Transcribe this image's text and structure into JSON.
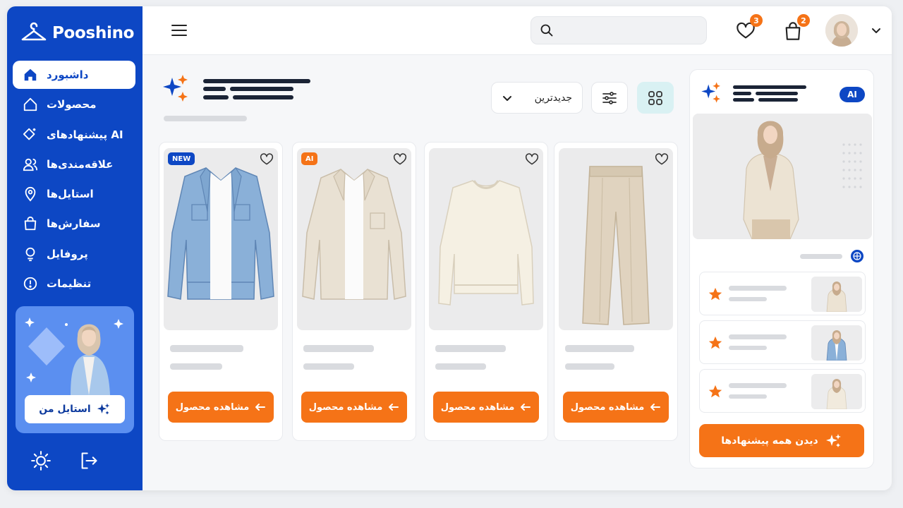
{
  "app": {
    "brand": "Pooshino"
  },
  "sidebar": {
    "items": [
      {
        "label": "داشبورد",
        "icon": "home-icon",
        "active": true
      },
      {
        "label": "محصولات",
        "icon": "tag-icon"
      },
      {
        "label": "پیشنهادهای AI",
        "icon": "ai-sparkle-icon"
      },
      {
        "label": "علاقه‌مندی‌ها",
        "icon": "users-icon"
      },
      {
        "label": "استایل‌ها",
        "icon": "pin-icon"
      },
      {
        "label": "سفارش‌ها",
        "icon": "bag-icon"
      },
      {
        "label": "پروفایل",
        "icon": "user-icon"
      },
      {
        "label": "تنظیمات",
        "icon": "settings-icon"
      }
    ],
    "promo_button_label": "استایل من"
  },
  "topbar": {
    "wishlist_count": "3",
    "cart_count": "2"
  },
  "filters": {
    "sort_label": "جدیدترین"
  },
  "products": [
    {
      "tag": "NEW",
      "tag_color": "#0d47c4",
      "cta": "مشاهده محصول",
      "item": "denim-jacket"
    },
    {
      "tag": "AI",
      "tag_color": "#f57317",
      "cta": "مشاهده محصول",
      "item": "beige-overshirt"
    },
    {
      "tag": "",
      "tag_color": "",
      "cta": "مشاهده محصول",
      "item": "cream-sweater"
    },
    {
      "tag": "",
      "tag_color": "",
      "cta": "مشاهده محصول",
      "item": "beige-trousers"
    }
  ],
  "ai_panel": {
    "badge": "AI",
    "cta_label": "دیدن همه پیشنهادها"
  },
  "colors": {
    "brand_blue": "#0d47c4",
    "accent_orange": "#f57317"
  }
}
